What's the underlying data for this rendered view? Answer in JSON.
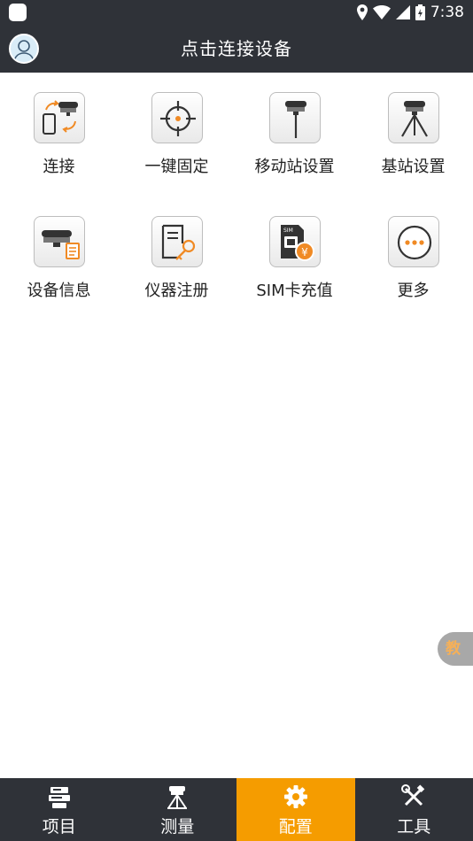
{
  "status_bar": {
    "time": "7:38"
  },
  "app_bar": {
    "title": "点击连接设备"
  },
  "grid": {
    "items": [
      {
        "label": "连接",
        "icon": "connect-icon"
      },
      {
        "label": "一键固定",
        "icon": "crosshair-icon"
      },
      {
        "label": "移动站设置",
        "icon": "rover-icon"
      },
      {
        "label": "基站设置",
        "icon": "base-station-icon"
      },
      {
        "label": "设备信息",
        "icon": "device-info-icon"
      },
      {
        "label": "仪器注册",
        "icon": "register-key-icon"
      },
      {
        "label": "SIM卡充值",
        "icon": "sim-recharge-icon"
      },
      {
        "label": "更多",
        "icon": "more-icon"
      }
    ]
  },
  "floating_tab": {
    "label": "教"
  },
  "bottom_nav": {
    "items": [
      {
        "label": "项目",
        "icon": "project-icon",
        "active": false
      },
      {
        "label": "测量",
        "icon": "survey-icon",
        "active": false
      },
      {
        "label": "配置",
        "icon": "gear-icon",
        "active": true
      },
      {
        "label": "工具",
        "icon": "tools-icon",
        "active": false
      }
    ]
  },
  "colors": {
    "bar": "#2f3238",
    "accent": "#f59c00",
    "orange_icon": "#f08a24"
  }
}
